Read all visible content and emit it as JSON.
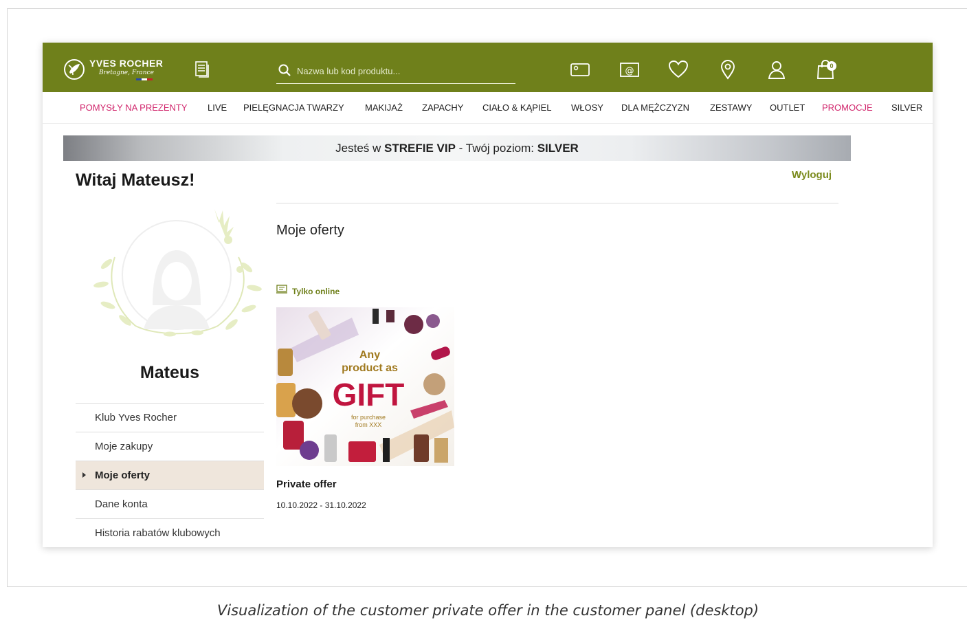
{
  "header": {
    "brand": "YVES ROCHER",
    "brand_sub": "Bretagne, France",
    "search_placeholder": "Nazwa lub kod produktu...",
    "cart_count": "0",
    "icons": [
      "catalog-icon",
      "search-icon",
      "gift-card-icon",
      "newsletter-icon",
      "heart-icon",
      "location-pin-icon",
      "user-icon",
      "shopping-bag-icon"
    ],
    "bar_color": "#6f801b"
  },
  "nav": {
    "items": [
      "POMYSŁY NA PREZENTY",
      "LIVE",
      "PIELĘGNACJA TWARZY",
      "MAKIJAŻ",
      "ZAPACHY",
      "CIAŁO & KĄPIEL",
      "WŁOSY",
      "DLA MĘŻCZYZN",
      "ZESTAWY",
      "OUTLET",
      "PROMOCJE",
      "SILVER"
    ],
    "accent_color": "#d1266c"
  },
  "vip": {
    "prefix": "Jesteś w ",
    "zone": "STREFIE VIP",
    "middle": " - Twój poziom: ",
    "level": "SILVER"
  },
  "account": {
    "greeting": "Witaj Mateusz!",
    "logout": "Wyloguj",
    "username": "Mateus"
  },
  "side_menu": {
    "items": [
      "Klub Yves Rocher",
      "Moje zakupy",
      "Moje oferty",
      "Dane konta",
      "Historia rabatów klubowych"
    ],
    "active": "Moje oferty"
  },
  "content": {
    "title": "Moje oferty",
    "tag": "Tylko online",
    "offer": {
      "image_line1": "Any",
      "image_line2": "product as",
      "image_big": "GIFT",
      "image_small1": "for purchase",
      "image_small2": "from XXX",
      "name": "Private offer",
      "dates": "10.10.2022 - 31.10.2022"
    }
  },
  "caption": "Visualization of the customer private offer in the customer panel (desktop)"
}
